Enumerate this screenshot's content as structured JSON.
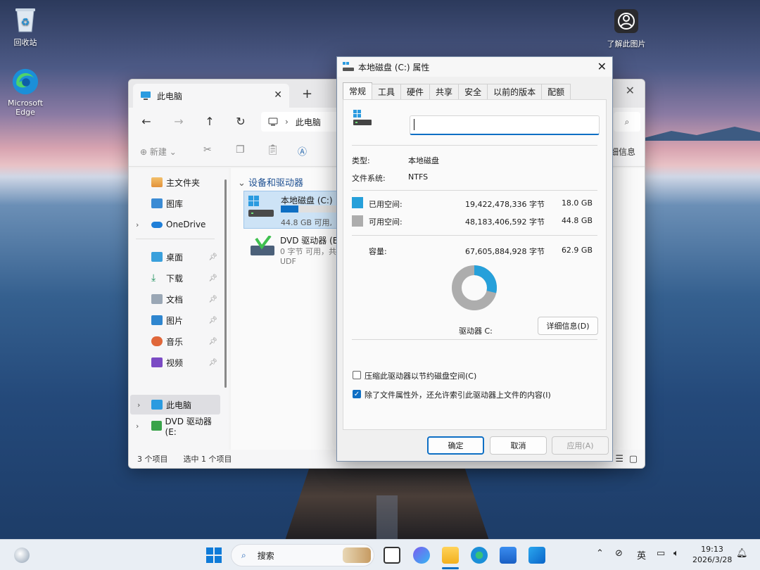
{
  "desktop": {
    "icons": [
      {
        "label": "回收站"
      },
      {
        "label": "Microsoft Edge"
      },
      {
        "label": "了解此图片"
      }
    ]
  },
  "explorer": {
    "tab_title": "此电脑",
    "address": "此电脑",
    "toolbar": {
      "new_label": "新建",
      "details_label": "细信息"
    },
    "sidebar": {
      "items": [
        {
          "label": "主文件夹"
        },
        {
          "label": "图库"
        },
        {
          "label": "OneDrive"
        },
        {
          "label": "桌面"
        },
        {
          "label": "下载"
        },
        {
          "label": "文档"
        },
        {
          "label": "图片"
        },
        {
          "label": "音乐"
        },
        {
          "label": "视频"
        },
        {
          "label": "此电脑"
        },
        {
          "label": "DVD 驱动器 (E:"
        }
      ]
    },
    "group_header": "设备和驱动器",
    "drives": [
      {
        "name": "本地磁盘 (C:)",
        "info": "44.8 GB 可用,",
        "used_fraction": 0.287
      },
      {
        "name": "DVD 驱动器 (E:",
        "info": "0 字节 可用，共",
        "fs": "UDF"
      }
    ],
    "status": {
      "count": "3 个项目",
      "selected": "选中 1 个项目"
    }
  },
  "dialog": {
    "title": "本地磁盘 (C:) 属性",
    "tabs": [
      "常规",
      "工具",
      "硬件",
      "共享",
      "安全",
      "以前的版本",
      "配额"
    ],
    "name_value": "",
    "type_label": "类型:",
    "type_value": "本地磁盘",
    "fs_label": "文件系统:",
    "fs_value": "NTFS",
    "used_label": "已用空间:",
    "used_bytes": "19,422,478,336 字节",
    "used_gb": "18.0 GB",
    "free_label": "可用空间:",
    "free_bytes": "48,183,406,592 字节",
    "free_gb": "44.8 GB",
    "capacity_label": "容量:",
    "capacity_bytes": "67,605,884,928 字节",
    "capacity_gb": "62.9 GB",
    "used_fraction": 0.287,
    "drive_label": "驱动器 C:",
    "details_button": "详细信息(D)",
    "compress_label": "压缩此驱动器以节约磁盘空间(C)",
    "compress_checked": false,
    "index_label": "除了文件属性外，还允许索引此驱动器上文件的内容(I)",
    "index_checked": true,
    "ok_button": "确定",
    "cancel_button": "取消",
    "apply_button": "应用(A)",
    "colors": {
      "used": "#26a0da",
      "free": "#adadad"
    }
  },
  "taskbar": {
    "search_label": "搜索",
    "ime": "英",
    "time": "19:13",
    "date": "2026/3/28"
  }
}
